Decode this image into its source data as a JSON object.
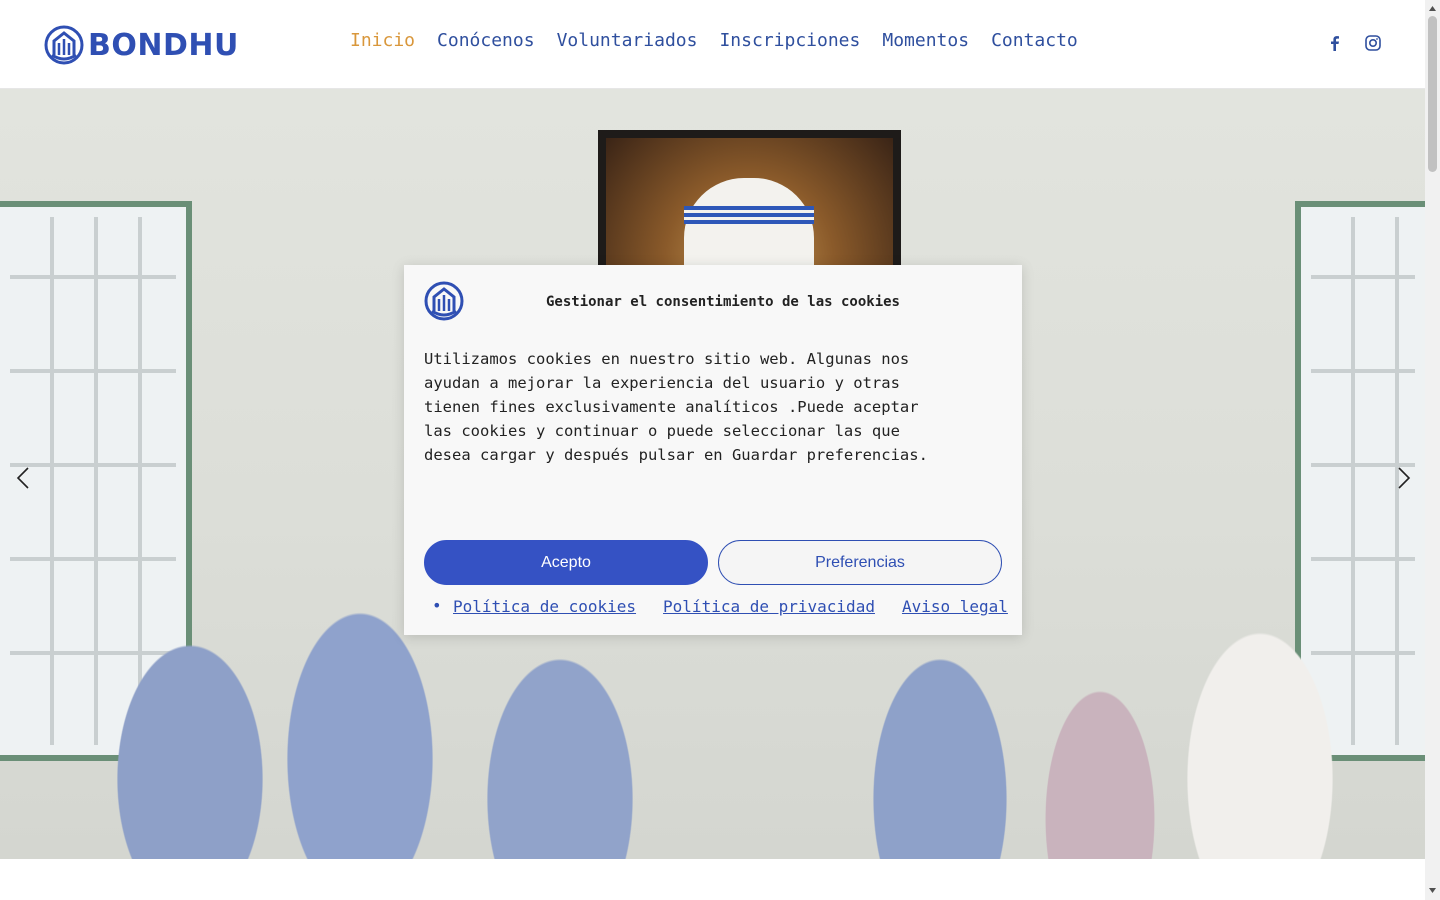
{
  "header": {
    "brand": "BONDHU",
    "nav": [
      {
        "label": "Inicio",
        "active": true
      },
      {
        "label": "Conócenos"
      },
      {
        "label": "Voluntariados"
      },
      {
        "label": "Inscripciones"
      },
      {
        "label": "Momentos"
      },
      {
        "label": "Contacto"
      }
    ],
    "social": [
      "facebook-icon",
      "instagram-icon"
    ]
  },
  "hero": {
    "prev_icon": "chevron-left-icon",
    "next_icon": "chevron-right-icon"
  },
  "cookie": {
    "title": "Gestionar el consentimiento de las cookies",
    "body": "Utilizamos cookies en nuestro sitio web. Algunas nos ayudan a mejorar la experiencia del usuario y otras tienen fines exclusivamente analíticos .Puede aceptar las cookies y continuar o puede seleccionar las que desea cargar y después pulsar en Guardar preferencias.",
    "accept_label": "Acepto",
    "preferences_label": "Preferencias",
    "links": [
      "Política de cookies",
      "Política de privacidad",
      "Aviso legal"
    ]
  },
  "colors": {
    "brand": "#2f4fb3",
    "nav_active": "#d9973b",
    "accept_button": "#3552c4"
  }
}
